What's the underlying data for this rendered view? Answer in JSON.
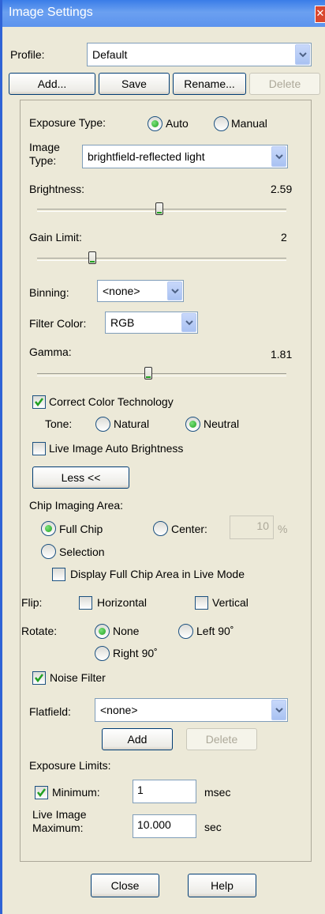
{
  "window": {
    "title": "Image Settings"
  },
  "profile": {
    "label": "Profile:",
    "value": "Default"
  },
  "profile_buttons": {
    "add": "Add...",
    "save": "Save",
    "rename": "Rename...",
    "delete": "Delete"
  },
  "exposure_type": {
    "label": "Exposure Type:",
    "auto": "Auto",
    "manual": "Manual",
    "selected": "Auto"
  },
  "image_type": {
    "label_line1": "Image",
    "label_line2": "Type:",
    "value": "brightfield-reflected light"
  },
  "brightness": {
    "label": "Brightness:",
    "value": "2.59",
    "slider_fraction": 0.52
  },
  "gain_limit": {
    "label": "Gain Limit:",
    "value": "2",
    "slider_fraction": 0.22
  },
  "binning": {
    "label": "Binning:",
    "value": "<none>"
  },
  "filter_color": {
    "label": "Filter Color:",
    "value": "RGB"
  },
  "gamma": {
    "label": "Gamma:",
    "value": "1.81",
    "slider_fraction": 0.47
  },
  "correct_color": {
    "label": "Correct Color Technology",
    "checked": true
  },
  "tone": {
    "label": "Tone:",
    "natural": "Natural",
    "neutral": "Neutral",
    "selected": "Neutral"
  },
  "live_auto_brightness": {
    "label": "Live Image Auto Brightness",
    "checked": false
  },
  "less_button": "Less <<",
  "chip_area": {
    "label": "Chip Imaging Area:",
    "full_chip": "Full Chip",
    "center": "Center:",
    "center_value": "10",
    "center_unit": "%",
    "selection": "Selection",
    "selected": "Full Chip",
    "display_full_chip": "Display Full Chip Area in Live Mode"
  },
  "flip": {
    "label": "Flip:",
    "horizontal": "Horizontal",
    "vertical": "Vertical"
  },
  "rotate": {
    "label": "Rotate:",
    "none": "None",
    "left90": "Left 90˚",
    "right90": "Right 90˚",
    "selected": "None"
  },
  "noise_filter": {
    "label": "Noise Filter",
    "checked": true
  },
  "flatfield": {
    "label": "Flatfield:",
    "value": "<none>",
    "add": "Add",
    "delete": "Delete"
  },
  "exposure_limits": {
    "label": "Exposure Limits:",
    "minimum_label": "Minimum:",
    "minimum_value": "1",
    "minimum_unit": "msec",
    "maximum_label_line1": "Live Image",
    "maximum_label_line2": "Maximum:",
    "maximum_value": "10.000",
    "maximum_unit": "sec"
  },
  "footer": {
    "close": "Close",
    "help": "Help"
  },
  "colors": {
    "titlebar": "#3A7DE8",
    "dialog_bg": "#ECE9D8",
    "button_border": "#003C74",
    "radio_dot": "#21A121"
  },
  "icons": {
    "close": "close-icon",
    "dropdown": "chevron-down-icon",
    "check": "checkmark-icon"
  }
}
